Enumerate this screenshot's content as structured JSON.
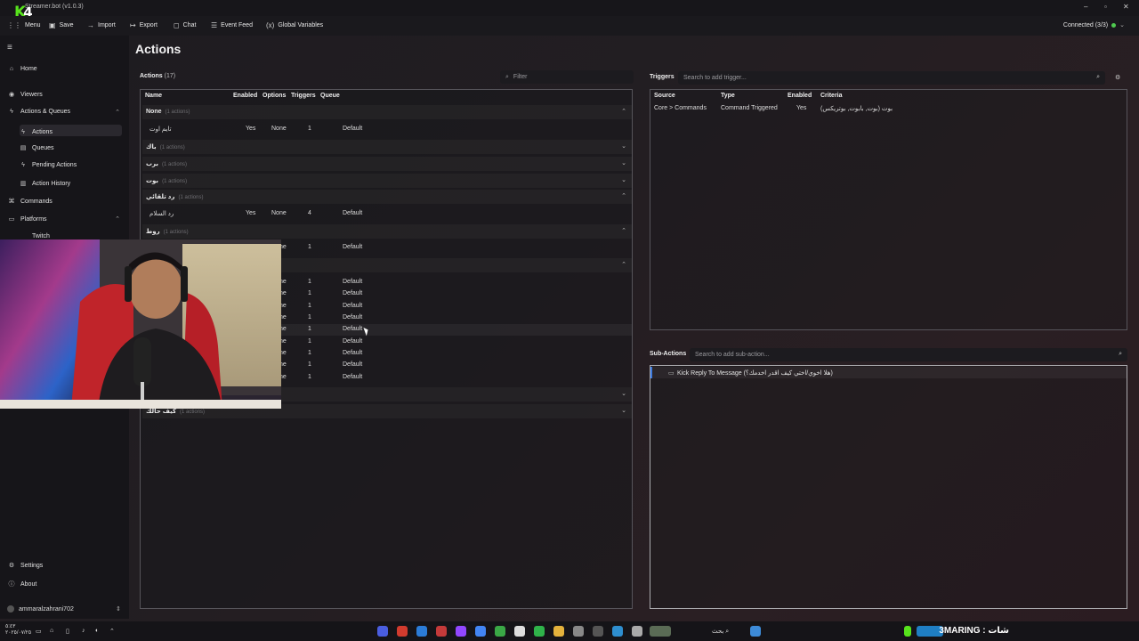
{
  "window": {
    "title": "Streamer.bot (v1.0.3)",
    "overlay_logo_letter": "K",
    "overlay_logo_number": "4",
    "minimize": "–",
    "maximize": "▫",
    "close": "✕"
  },
  "toolbar": {
    "menu": "Menu",
    "save": "Save",
    "import": "Import",
    "export": "Export",
    "chat": "Chat",
    "event_feed": "Event Feed",
    "global_variables": "Global Variables",
    "connection": "Connected (3/3)"
  },
  "sidebar": {
    "home": "Home",
    "viewers": "Viewers",
    "actions_queues": "Actions & Queues",
    "actions": "Actions",
    "queues": "Queues",
    "pending_actions": "Pending Actions",
    "action_history": "Action History",
    "commands": "Commands",
    "platforms": "Platforms",
    "twitch": "Twitch",
    "settings": "Settings",
    "about": "About",
    "username": "ammaralzahrani702"
  },
  "page": {
    "title": "Actions"
  },
  "actions": {
    "heading": "Actions",
    "count": "(17)",
    "filter_placeholder": "Filter",
    "columns": {
      "name": "Name",
      "enabled": "Enabled",
      "options": "Options",
      "triggers": "Triggers",
      "queue": "Queue"
    },
    "groups": [
      {
        "name": "None",
        "count": "(1 actions)",
        "expanded": true
      },
      {
        "name": "باك",
        "count": "(1 actions)",
        "expanded": false
      },
      {
        "name": "برب",
        "count": "(1 actions)",
        "expanded": false
      },
      {
        "name": "بوت",
        "count": "(1 actions)",
        "expanded": false
      },
      {
        "name": "رد تلقائي",
        "count": "(1 actions)",
        "expanded": true
      },
      {
        "name": "روط",
        "count": "(1 actions)",
        "expanded": true
      },
      {
        "name": "",
        "count": "",
        "expanded": true
      },
      {
        "name": "",
        "count": "",
        "expanded": false
      },
      {
        "name": "كيف حالك",
        "count": "(1 actions)",
        "expanded": false
      }
    ],
    "rows": [
      {
        "name": "تايم اوت",
        "enabled": "Yes",
        "options": "None",
        "triggers": "1",
        "queue": "Default"
      },
      {
        "name": "رد السلام",
        "enabled": "Yes",
        "options": "None",
        "triggers": "4",
        "queue": "Default"
      },
      {
        "name": "",
        "enabled": "",
        "options": "None",
        "triggers": "1",
        "queue": "Default"
      },
      {
        "name": "",
        "enabled": "",
        "options": "None",
        "triggers": "1",
        "queue": "Default"
      },
      {
        "name": "",
        "enabled": "",
        "options": "None",
        "triggers": "1",
        "queue": "Default"
      },
      {
        "name": "",
        "enabled": "",
        "options": "None",
        "triggers": "1",
        "queue": "Default"
      },
      {
        "name": "",
        "enabled": "",
        "options": "None",
        "triggers": "1",
        "queue": "Default"
      },
      {
        "name": "",
        "enabled": "",
        "options": "None",
        "triggers": "1",
        "queue": "Default"
      },
      {
        "name": "",
        "enabled": "",
        "options": "None",
        "triggers": "1",
        "queue": "Default"
      },
      {
        "name": "",
        "enabled": "",
        "options": "None",
        "triggers": "1",
        "queue": "Default"
      },
      {
        "name": "",
        "enabled": "",
        "options": "None",
        "triggers": "1",
        "queue": "Default"
      },
      {
        "name": "",
        "enabled": "",
        "options": "None",
        "triggers": "1",
        "queue": "Default"
      }
    ]
  },
  "triggers": {
    "heading": "Triggers",
    "search_placeholder": "Search to add trigger...",
    "columns": {
      "source": "Source",
      "type": "Type",
      "enabled": "Enabled",
      "criteria": "Criteria"
    },
    "rows": [
      {
        "source": "Core > Commands",
        "type": "Command Triggered",
        "enabled": "Yes",
        "criteria": "بوت (بوت, بابوت, بوتريكس)"
      }
    ]
  },
  "subactions": {
    "heading": "Sub-Actions",
    "search_placeholder": "Search to add sub-action...",
    "items": [
      {
        "label": "Kick Reply To Message (هلا اخوي/اختي كيف اقدر اخدمك؟)"
      }
    ]
  },
  "taskbar": {
    "search_text": "بحث",
    "clock_time": "٥:٤٣",
    "clock_date": "٢٠٢٥/٠٧/٢٥",
    "stream_brand": "3MARING : شات"
  },
  "colors": {
    "accent_green": "#4fca4f",
    "kick_green": "#57e31c",
    "selection_blue": "#3d7be0"
  }
}
